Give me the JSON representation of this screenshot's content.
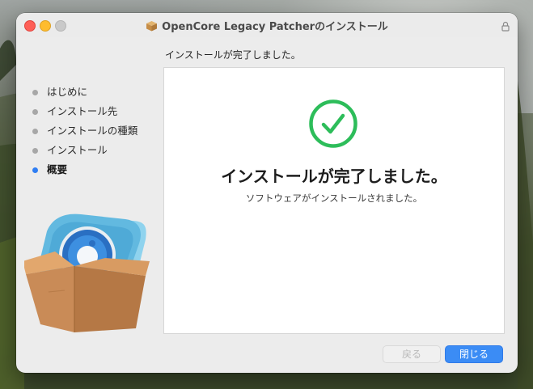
{
  "window": {
    "title": "OpenCore Legacy Patcherのインストール"
  },
  "header": {
    "subtitle": "インストールが完了しました。"
  },
  "sidebar": {
    "steps": [
      {
        "label": "はじめに",
        "active": false
      },
      {
        "label": "インストール先",
        "active": false
      },
      {
        "label": "インストールの種類",
        "active": false
      },
      {
        "label": "インストール",
        "active": false
      },
      {
        "label": "概要",
        "active": true
      }
    ]
  },
  "main": {
    "heading": "インストールが完了しました。",
    "message": "ソフトウェアがインストールされました。"
  },
  "footer": {
    "back_label": "戻る",
    "close_label": "閉じる"
  },
  "colors": {
    "accent": "#3b8cf5",
    "success": "#2dbd5a",
    "active_step": "#2f7ef3"
  },
  "icons": [
    "package-icon",
    "lock-icon",
    "checkmark-circle-icon",
    "installer-box-icon"
  ]
}
